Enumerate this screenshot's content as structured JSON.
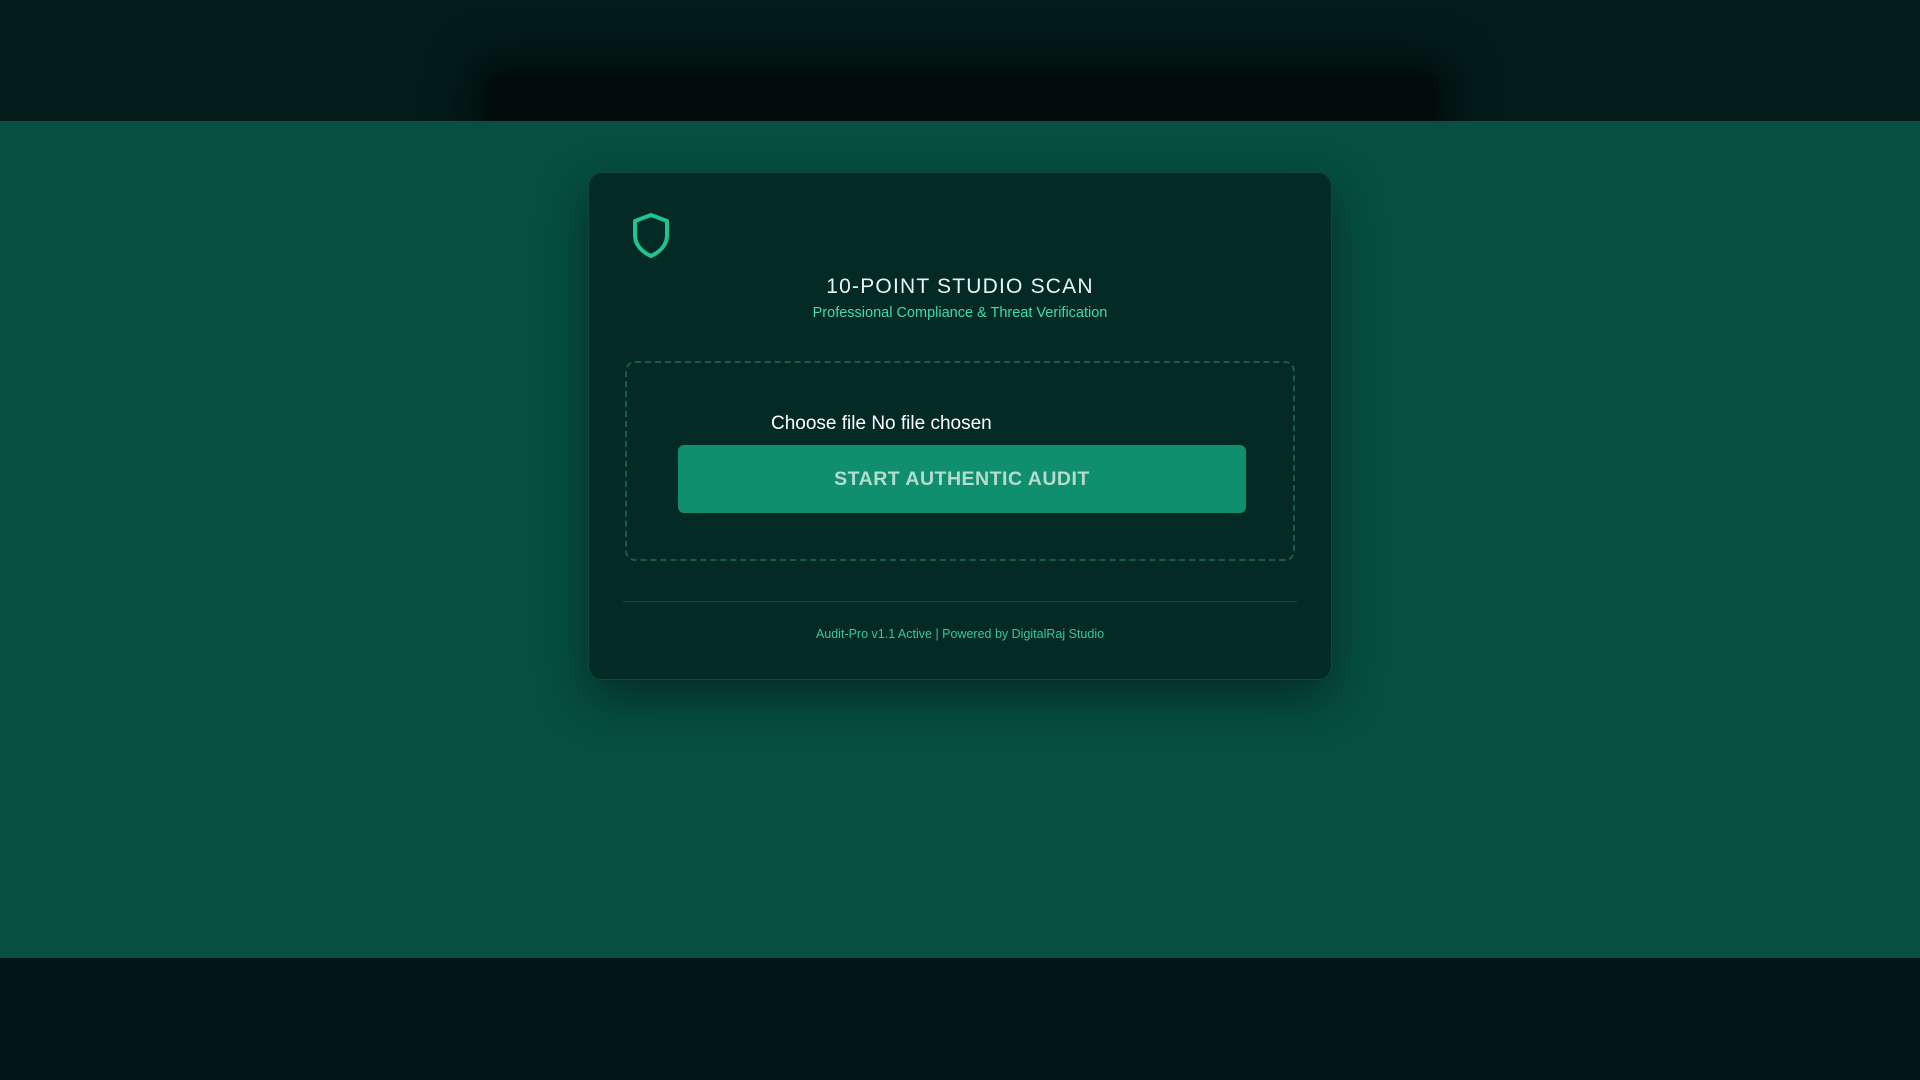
{
  "card": {
    "icon": "shield-icon",
    "title": "10-POINT STUDIO SCAN",
    "subtitle": "Professional Compliance & Threat Verification"
  },
  "upload": {
    "file_input_label": "Choose file No file chosen",
    "start_button_label": "START AUTHENTIC AUDIT"
  },
  "footer": {
    "text": "Audit-Pro v1.1 Active | Powered by DigitalRaj Studio"
  },
  "colors": {
    "accent": "#0f8f6e",
    "accent_text": "#3fdcaa",
    "background": "#064f42",
    "card": "#032a24"
  }
}
